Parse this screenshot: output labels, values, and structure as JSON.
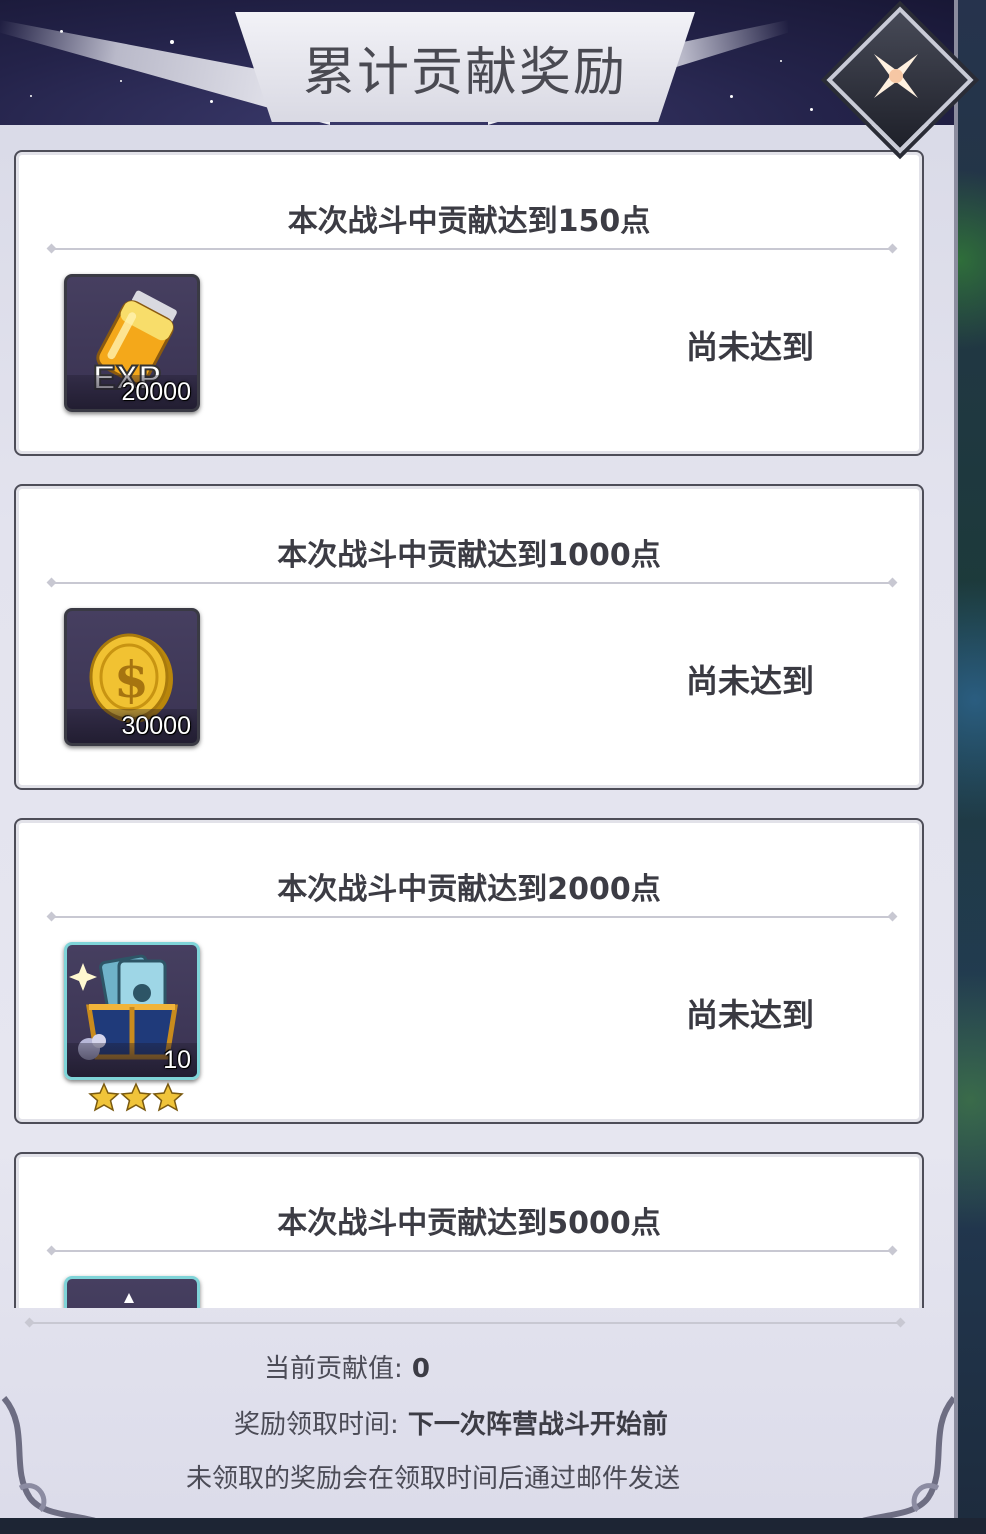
{
  "dialog": {
    "title": "累计贡献奖励",
    "close_icon": "close-x-icon"
  },
  "rewards": [
    {
      "requirement": "本次战斗中贡献达到150点",
      "item_icon": "exp-potion-icon",
      "item_text": "EXP",
      "quantity": "20000",
      "status": "尚未达到"
    },
    {
      "requirement": "本次战斗中贡献达到1000点",
      "item_icon": "gold-coin-icon",
      "quantity": "30000",
      "status": "尚未达到"
    },
    {
      "requirement": "本次战斗中贡献达到2000点",
      "item_icon": "card-chest-icon",
      "quantity": "10",
      "stars": 3,
      "status": "尚未达到"
    },
    {
      "requirement": "本次战斗中贡献达到5000点",
      "item_icon": "card-chest-icon"
    }
  ],
  "footer": {
    "contribution_label": "当前贡献值:",
    "contribution_value": "0",
    "claim_time_label": "奖励领取时间:",
    "claim_time_value": "下一次阵营战斗开始前",
    "notice": "未领取的奖励会在领取时间后通过邮件发送"
  },
  "colors": {
    "header_bg": "#24234a",
    "card_bg": "#ffffff",
    "rare_border": "#7fd4d8",
    "text_dark": "#3c3c44"
  }
}
